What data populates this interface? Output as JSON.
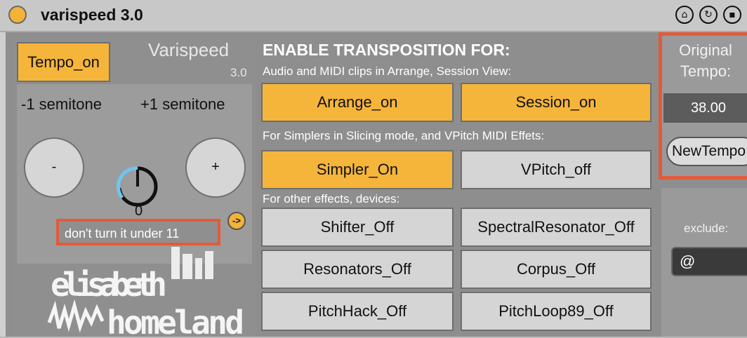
{
  "titlebar": {
    "title": "varispeed 3.0"
  },
  "left": {
    "tempo_button": "Tempo_on",
    "name": "Varispeed",
    "version": "3.0",
    "minus_label": "-1 semitone",
    "plus_label": "+1 semitone",
    "minus_button": "-",
    "plus_button": "+",
    "dial_value": "0",
    "arrow_button": "->",
    "warning": "don't turn it under 11",
    "logo_text_1": "elisabeth",
    "logo_text_2": "homeland"
  },
  "mid": {
    "header": "ENABLE TRANSPOSITION FOR:",
    "sub1": "Audio and MIDI clips in Arrange, Session View:",
    "arrange": "Arrange_on",
    "session": "Session_on",
    "sub2": "For Simplers in Slicing mode, and VPitch MIDI Effets:",
    "simpler": "Simpler_On",
    "vpitch": "VPitch_off",
    "sub3": "For other effects, devices:",
    "shifter": "Shifter_Off",
    "spectral": "SpectralResonator_Off",
    "resonators": "Resonators_Off",
    "corpus": "Corpus_Off",
    "pitchhack": "PitchHack_Off",
    "pitchloop": "PitchLoop89_Off"
  },
  "right": {
    "orig_label_1": "Original",
    "orig_label_2": "Tempo:",
    "tempo_value": "38.00",
    "newtempo": "NewTempo",
    "exclude_label": "exclude:",
    "exclude_value": "@"
  },
  "colors": {
    "accent": "#f5b53b",
    "highlight": "#e35a3b",
    "dial": "#6ec6f0"
  }
}
